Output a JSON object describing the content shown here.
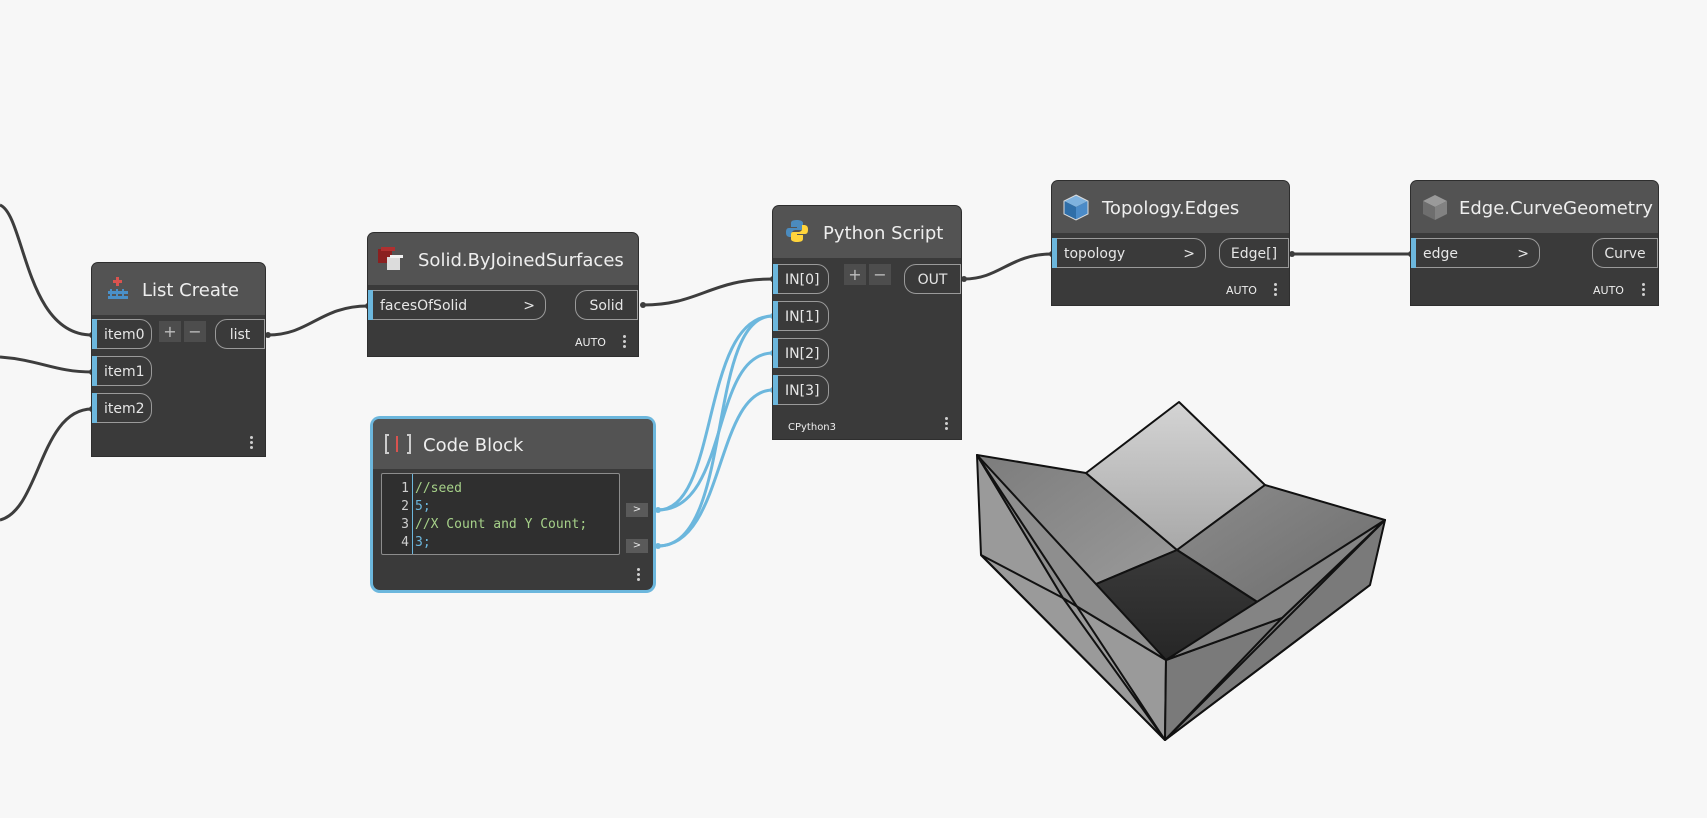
{
  "nodes": {
    "list_create": {
      "title": "List Create",
      "inputs": [
        "item0",
        "item1",
        "item2"
      ],
      "output": "list",
      "add_label": "+",
      "remove_label": "−"
    },
    "solid_by_joined_surfaces": {
      "title": "Solid.ByJoinedSurfaces",
      "input": "facesOfSolid",
      "input_arrow": ">",
      "output": "Solid",
      "mode": "AUTO"
    },
    "code_block": {
      "title": "Code Block",
      "lines": [
        {
          "num": "1",
          "text": "//seed",
          "color": "#a6d189"
        },
        {
          "num": "2",
          "text": "5;",
          "color": "#6cb7dd"
        },
        {
          "num": "3",
          "text": "//X Count and Y Count;",
          "color": "#a6d189"
        },
        {
          "num": "4",
          "text": "3;",
          "color": "#6cb7dd"
        }
      ],
      "output_arrow": ">"
    },
    "python_script": {
      "title": "Python Script",
      "inputs": [
        "IN[0]",
        "IN[1]",
        "IN[2]",
        "IN[3]"
      ],
      "output": "OUT",
      "engine": "CPython3",
      "add_label": "+",
      "remove_label": "−"
    },
    "topology_edges": {
      "title": "Topology.Edges",
      "input": "topology",
      "input_arrow": ">",
      "output": "Edge[]",
      "mode": "AUTO"
    },
    "edge_curve_geometry": {
      "title": "Edge.CurveGeometry",
      "input": "edge",
      "input_arrow": ">",
      "output": "Curve",
      "mode": "AUTO"
    }
  },
  "colors": {
    "canvas": "#f7f7f7",
    "node_body": "#3a3a3a",
    "node_header": "#535353",
    "wire": "#3d3d3d",
    "selected_wire": "#6cb7dd",
    "port_accent": "#6cb7dd"
  },
  "icons": {
    "list_create": "list-create-icon",
    "solid": "solid-icon",
    "code_block": "code-block-icon",
    "python": "python-icon",
    "topology": "topology-cube-icon",
    "edge": "edge-cube-icon",
    "menu": "more-vertical-icon"
  }
}
